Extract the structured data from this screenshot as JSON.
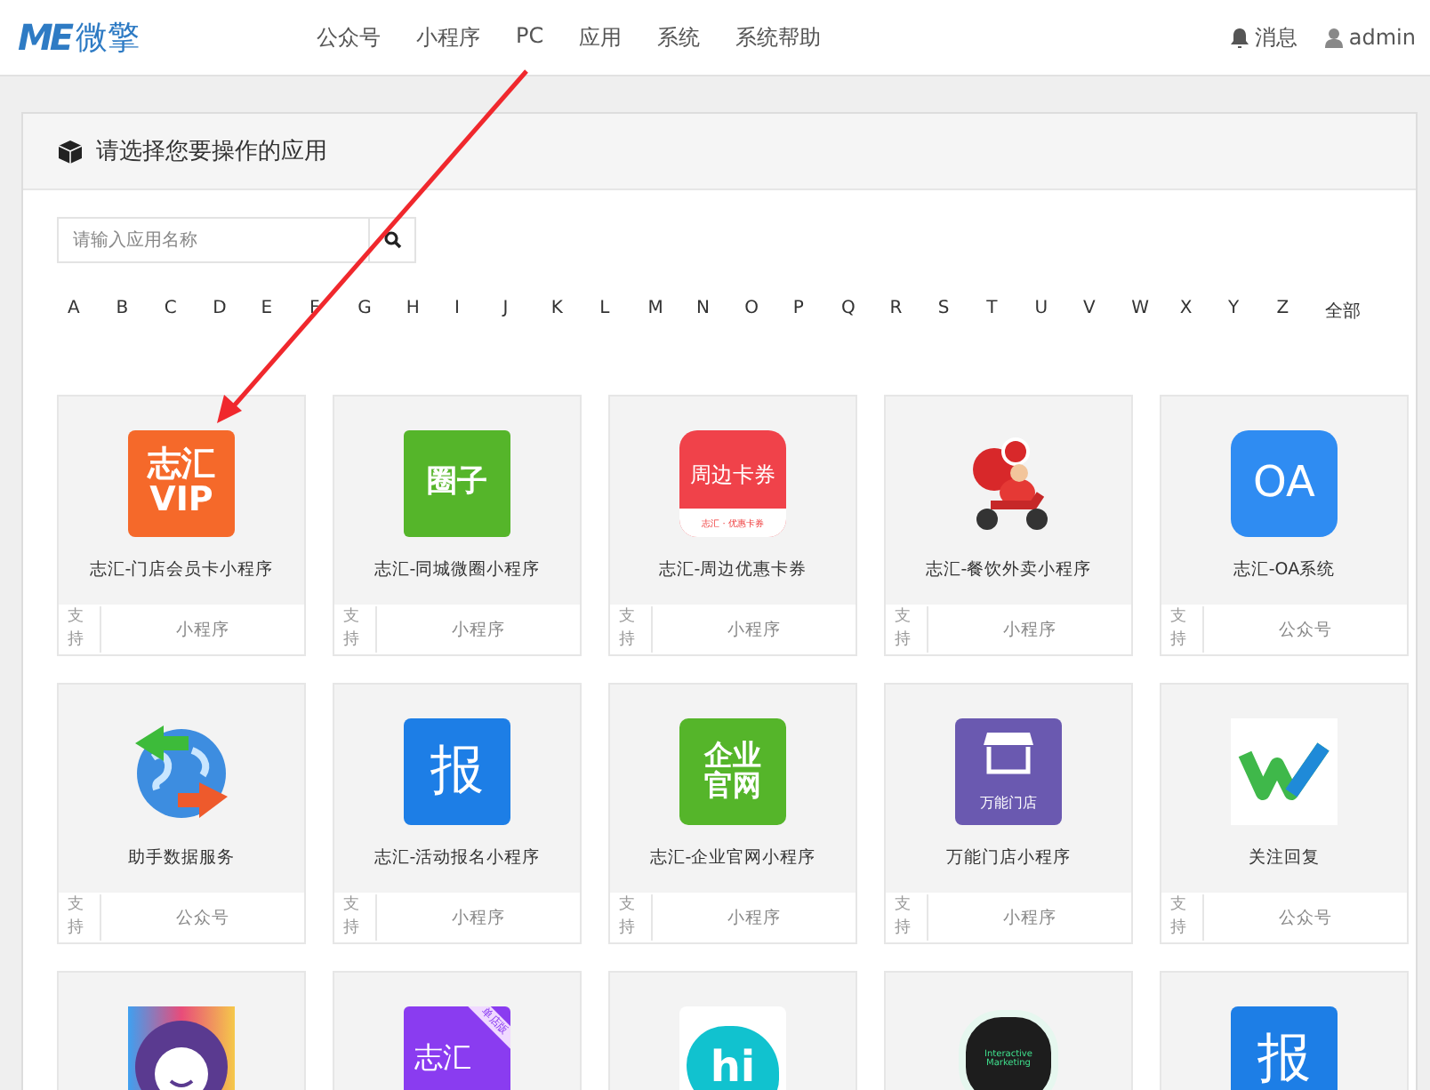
{
  "header": {
    "logo_mark": "ME",
    "logo_text": "微擎",
    "nav": [
      "公众号",
      "小程序",
      "PC",
      "应用",
      "系统",
      "系统帮助"
    ],
    "messages": "消息",
    "user": "admin"
  },
  "panel": {
    "title": "请选择您要操作的应用",
    "search": {
      "placeholder": "请输入应用名称"
    },
    "letters": [
      "A",
      "B",
      "C",
      "D",
      "E",
      "F",
      "G",
      "H",
      "I",
      "J",
      "K",
      "L",
      "M",
      "N",
      "O",
      "P",
      "Q",
      "R",
      "S",
      "T",
      "U",
      "V",
      "W",
      "X",
      "Y",
      "Z",
      "全部"
    ],
    "apps": [
      {
        "icon": {
          "kind": "vip",
          "text": [
            "志汇",
            "VIP"
          ]
        },
        "name": "志汇-门店会员卡小程序",
        "support": "支持",
        "platform": "小程序"
      },
      {
        "icon": {
          "kind": "quanzi",
          "text": [
            "圈子"
          ]
        },
        "name": "志汇-同城微圈小程序",
        "support": "支持",
        "platform": "小程序"
      },
      {
        "icon": {
          "kind": "coupon",
          "text": [
            "周边卡券",
            "志汇 · 优惠卡券"
          ]
        },
        "name": "志汇-周边优惠卡券",
        "support": "支持",
        "platform": "小程序"
      },
      {
        "icon": {
          "kind": "delivery"
        },
        "name": "志汇-餐饮外卖小程序",
        "support": "支持",
        "platform": "小程序"
      },
      {
        "icon": {
          "kind": "oa",
          "text": [
            "OA"
          ]
        },
        "name": "志汇-OA系统",
        "support": "支持",
        "platform": "公众号"
      },
      {
        "icon": {
          "kind": "globe"
        },
        "name": "助手数据服务",
        "support": "支持",
        "platform": "公众号"
      },
      {
        "icon": {
          "kind": "bao",
          "text": [
            "报"
          ]
        },
        "name": "志汇-活动报名小程序",
        "support": "支持",
        "platform": "小程序"
      },
      {
        "icon": {
          "kind": "website",
          "text": [
            "企业",
            "官网"
          ]
        },
        "name": "志汇-企业官网小程序",
        "support": "支持",
        "platform": "小程序"
      },
      {
        "icon": {
          "kind": "store",
          "text": [
            "万能门店"
          ]
        },
        "name": "万能门店小程序",
        "support": "支持",
        "platform": "小程序"
      },
      {
        "icon": {
          "kind": "wave"
        },
        "name": "关注回复",
        "support": "支持",
        "platform": "公众号"
      },
      {
        "icon": {
          "kind": "face"
        }
      },
      {
        "icon": {
          "kind": "hotel",
          "text": [
            "志汇"
          ],
          "badge": "单店版"
        }
      },
      {
        "icon": {
          "kind": "hi",
          "text": [
            "hi"
          ]
        }
      },
      {
        "icon": {
          "kind": "marketing",
          "text": [
            "Interactive",
            "Marketing"
          ]
        }
      },
      {
        "icon": {
          "kind": "bao",
          "text": [
            "报"
          ]
        }
      }
    ]
  }
}
